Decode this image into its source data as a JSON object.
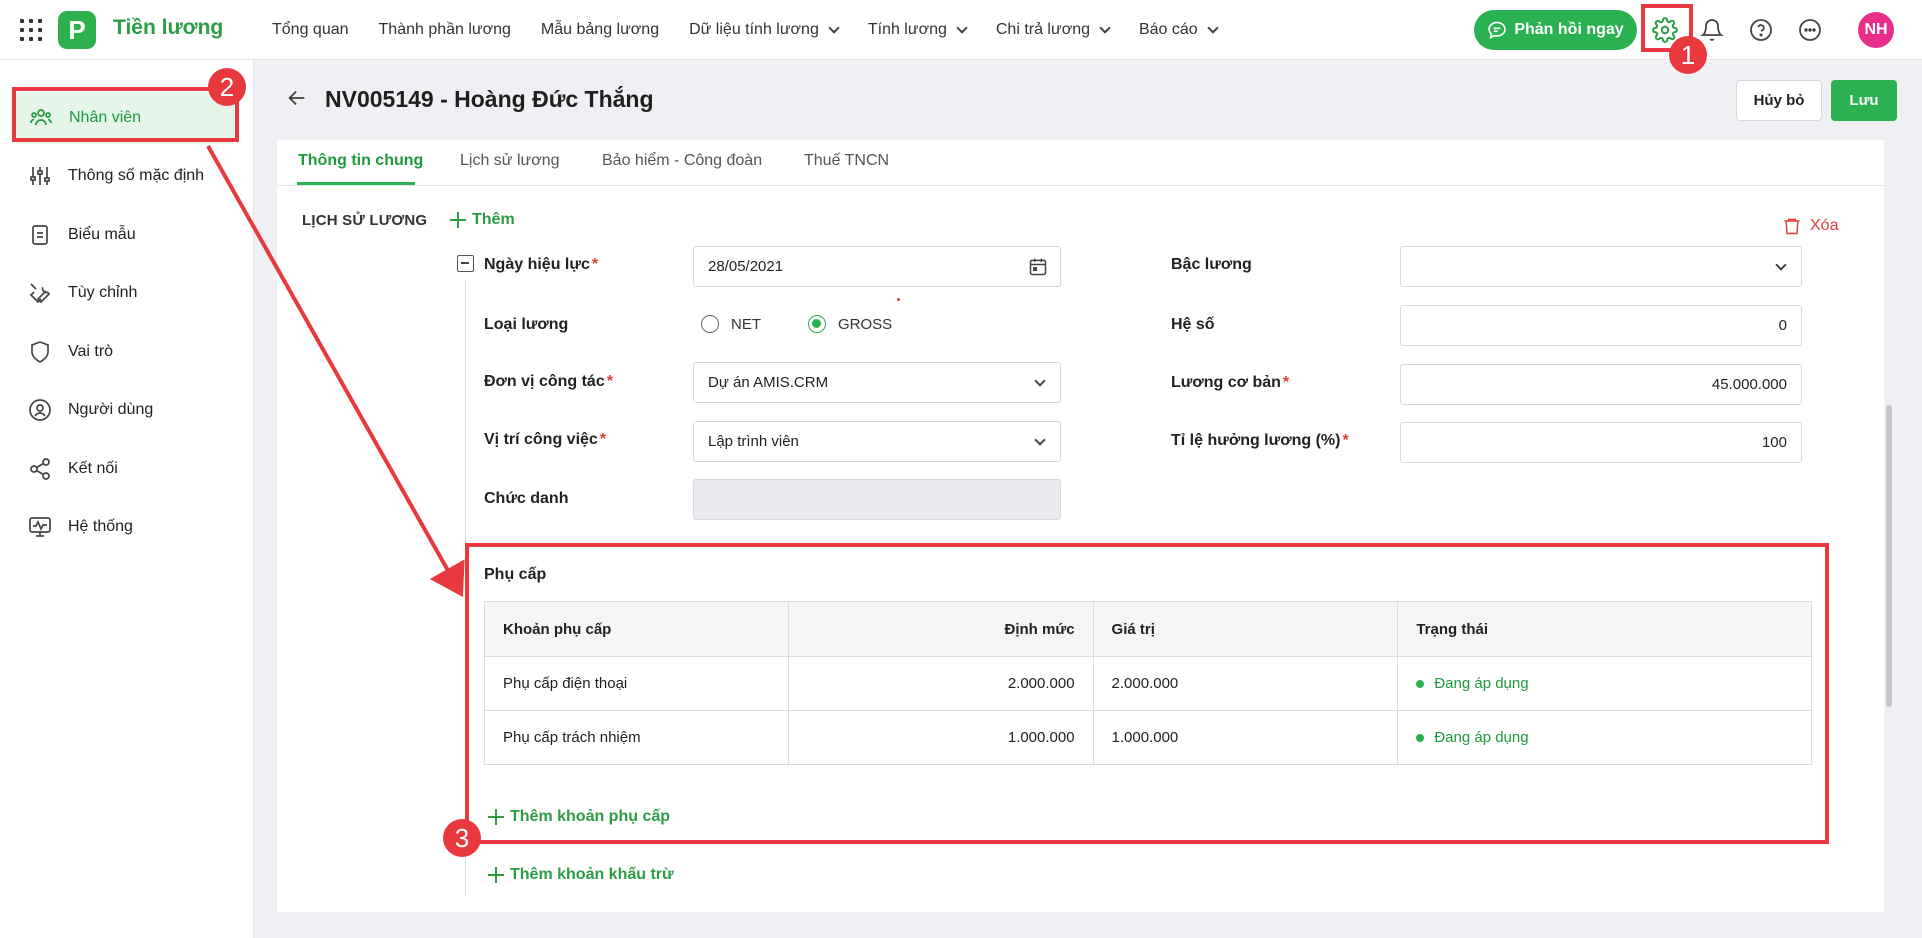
{
  "app": {
    "name": "Tiền lương",
    "logo_letter": "P"
  },
  "nav": [
    {
      "label": "Tổng quan",
      "has_dropdown": false
    },
    {
      "label": "Thành phần lương",
      "has_dropdown": false
    },
    {
      "label": "Mẫu bảng lương",
      "has_dropdown": false
    },
    {
      "label": "Dữ liệu tính lương",
      "has_dropdown": true
    },
    {
      "label": "Tính lương",
      "has_dropdown": true
    },
    {
      "label": "Chi trả lương",
      "has_dropdown": true
    },
    {
      "label": "Báo cáo",
      "has_dropdown": true
    }
  ],
  "topbar": {
    "feedback_label": "Phản hồi ngay",
    "avatar_initials": "NH"
  },
  "sidebar": {
    "items": [
      {
        "label": "Nhân viên",
        "icon": "users-icon",
        "active": true
      },
      {
        "label": "Thông số mặc định",
        "icon": "sliders-icon",
        "active": false
      },
      {
        "label": "Biểu mẫu",
        "icon": "document-icon",
        "active": false
      },
      {
        "label": "Tùy chỉnh",
        "icon": "tools-icon",
        "active": false
      },
      {
        "label": "Vai trò",
        "icon": "shield-icon",
        "active": false
      },
      {
        "label": "Người dùng",
        "icon": "user-circle-icon",
        "active": false
      },
      {
        "label": "Kết nối",
        "icon": "share-icon",
        "active": false
      },
      {
        "label": "Hệ thống",
        "icon": "monitor-icon",
        "active": false
      }
    ]
  },
  "header": {
    "title": "NV005149 - Hoàng Đức Thắng",
    "cancel_label": "Hủy bỏ",
    "save_label": "Lưu"
  },
  "tabs": [
    {
      "label": "Thông tin chung",
      "active": true
    },
    {
      "label": "Lịch sử lương",
      "active": false
    },
    {
      "label": "Bảo hiểm - Công đoàn",
      "active": false
    },
    {
      "label": "Thuế TNCN",
      "active": false
    }
  ],
  "salary_history": {
    "section_label": "LỊCH SỬ LƯƠNG",
    "add_label": "Thêm",
    "delete_label": "Xóa",
    "fields": {
      "effective_date": {
        "label": "Ngày hiệu lực",
        "value": "28/05/2021",
        "required": true
      },
      "salary_type": {
        "label": "Loại lương",
        "options": [
          "NET",
          "GROSS"
        ],
        "selected": "GROSS"
      },
      "unit": {
        "label": "Đơn vị công tác",
        "value": "Dự án AMIS.CRM",
        "required": true
      },
      "position": {
        "label": "Vị trí công việc",
        "value": "Lập trình viên",
        "required": true
      },
      "title": {
        "label": "Chức danh",
        "value": ""
      },
      "grade": {
        "label": "Bậc lương",
        "value": ""
      },
      "coefficient": {
        "label": "Hệ số",
        "value": "0"
      },
      "base_salary": {
        "label": "Lương cơ bản",
        "value": "45.000.000",
        "required": true
      },
      "salary_rate": {
        "label": "Tỉ lệ hưởng lương (%)",
        "value": "100",
        "required": true
      }
    },
    "allowance": {
      "title": "Phụ cấp",
      "columns": [
        "Khoản phụ cấp",
        "Định mức",
        "Giá trị",
        "Trạng thái"
      ],
      "rows": [
        {
          "name": "Phụ cấp điện thoại",
          "norm": "2.000.000",
          "value": "2.000.000",
          "status": "Đang áp dụng"
        },
        {
          "name": "Phụ cấp trách nhiệm",
          "norm": "1.000.000",
          "value": "1.000.000",
          "status": "Đang áp dụng"
        }
      ],
      "add_label": "Thêm khoản phụ cấp"
    },
    "add_deduction_label": "Thêm khoản khấu trừ"
  },
  "annotations": {
    "badge_1": "1",
    "badge_2": "2",
    "badge_3": "3"
  },
  "colors": {
    "brand": "#2ab151",
    "annotation": "#e8393f",
    "danger": "#e03b3b"
  }
}
